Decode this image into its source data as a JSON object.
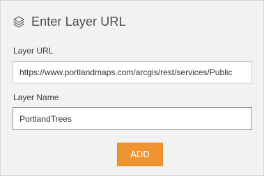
{
  "header": {
    "icon": "layers-icon",
    "title": "Enter Layer URL"
  },
  "form": {
    "url_label": "Layer URL",
    "url_value": "https://www.portlandmaps.com/arcgis/rest/services/Public",
    "name_label": "Layer Name",
    "name_value": "PortlandTrees"
  },
  "actions": {
    "add_label": "ADD"
  },
  "colors": {
    "accent": "#ee9431",
    "panel_bg": "#f2f2f2",
    "text": "#4c4c4c"
  }
}
